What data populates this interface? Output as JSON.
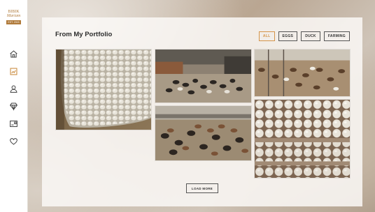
{
  "brand": {
    "line1": "BIBIK",
    "line2": "Mariam",
    "badge": "EST. 2015"
  },
  "sidebar": {
    "items": [
      {
        "icon": "home-icon"
      },
      {
        "icon": "portfolio-icon",
        "active": true
      },
      {
        "icon": "user-icon"
      },
      {
        "icon": "diamond-icon"
      },
      {
        "icon": "card-icon"
      },
      {
        "icon": "heart-icon"
      }
    ]
  },
  "portfolio": {
    "title": "From My Portfolio",
    "filters": [
      "ALL",
      "EGGS",
      "DUCK",
      "FARMING"
    ],
    "active_filter": "ALL",
    "load_more_label": "LOAD MORE"
  },
  "colors": {
    "accent": "#d5954a",
    "sidebar_active": "#c98a3c",
    "icon": "#3a3a3a"
  }
}
